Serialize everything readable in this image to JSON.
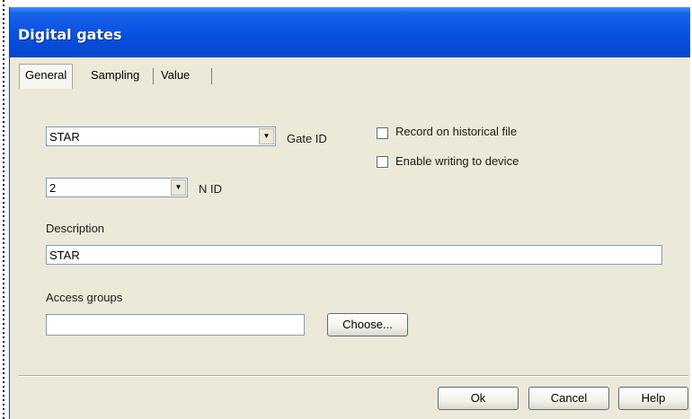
{
  "window": {
    "title": "Digital gates"
  },
  "tabs": [
    {
      "label": "General"
    },
    {
      "label": "Sampling"
    },
    {
      "label": "Value"
    }
  ],
  "general": {
    "gate_id": {
      "value": "STAR",
      "label": "Gate ID"
    },
    "n_id": {
      "value": "2",
      "label": "N ID"
    },
    "record_historical": {
      "label": "Record on historical file",
      "checked": false
    },
    "enable_writing": {
      "label": "Enable writing to device",
      "checked": false
    },
    "description": {
      "label": "Description",
      "value": "STAR"
    },
    "access_groups": {
      "label": "Access groups",
      "value": "",
      "choose_label": "Choose..."
    }
  },
  "footer": {
    "ok_label": "Ok",
    "cancel_label": "Cancel",
    "help_label": "Help"
  }
}
